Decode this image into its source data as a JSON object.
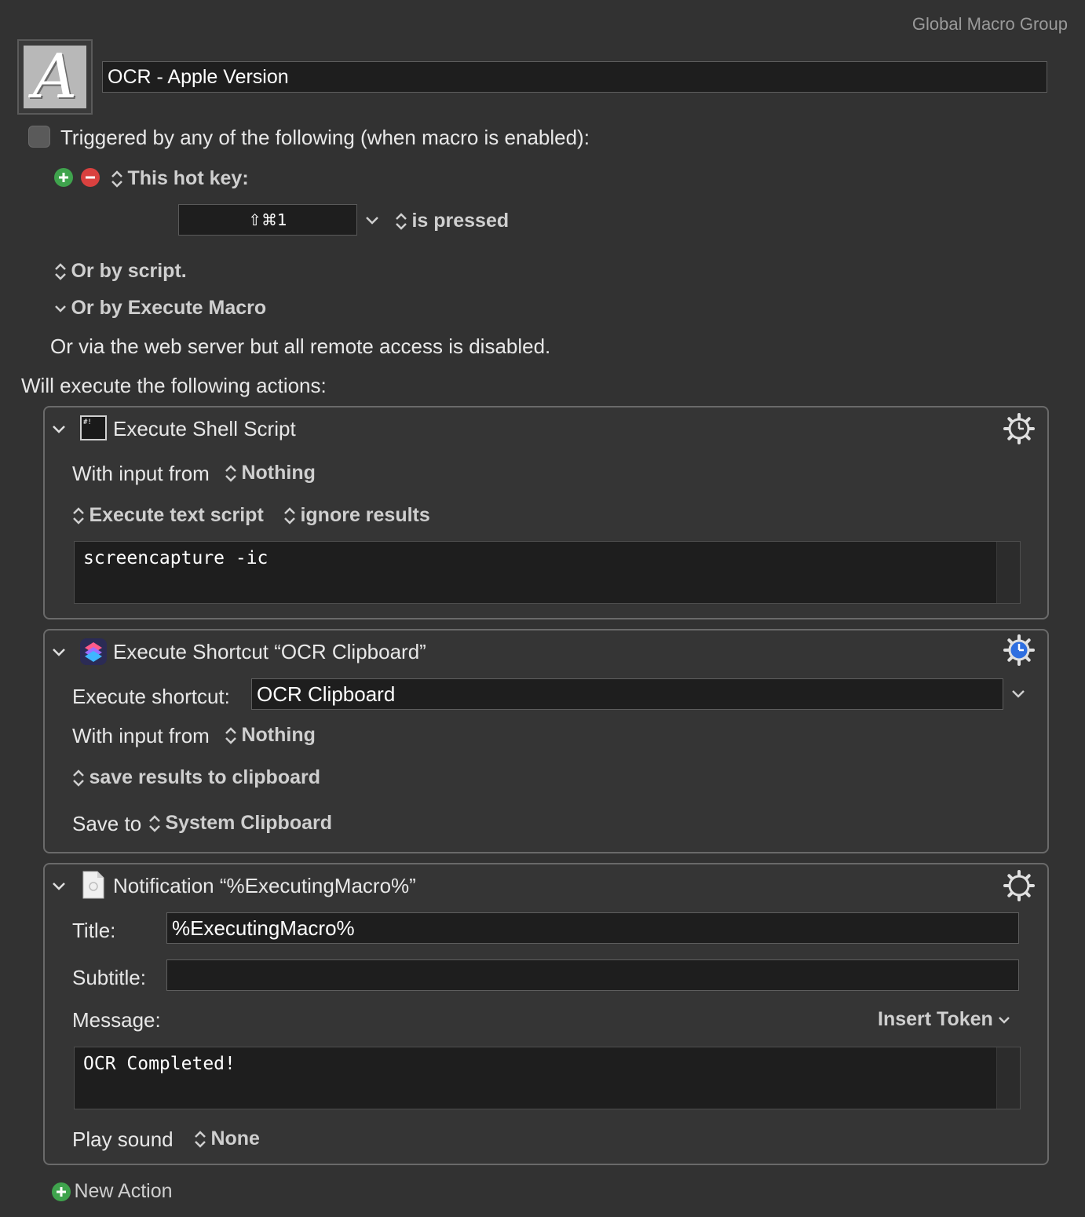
{
  "header": {
    "group": "Global Macro Group",
    "macro_name": "OCR - Apple Version"
  },
  "triggers": {
    "heading": "Triggered by any of the following (when macro is enabled):",
    "hotkey_label": "This hot key:",
    "hotkey_value": "⇧⌘1",
    "hotkey_state": "is pressed",
    "by_script": "Or by script.",
    "by_execute_macro": "Or by Execute Macro",
    "web_server": "Or via the web server but all remote access is disabled."
  },
  "actions_heading": "Will execute the following actions:",
  "actions": {
    "shell": {
      "title": "Execute Shell Script",
      "input_label": "With input from",
      "input_value": "Nothing",
      "mode": "Execute text script",
      "results": "ignore results",
      "script": "screencapture -ic"
    },
    "shortcut": {
      "title": "Execute Shortcut “OCR Clipboard”",
      "shortcut_label": "Execute shortcut:",
      "shortcut_value": "OCR Clipboard",
      "input_label": "With input from",
      "input_value": "Nothing",
      "results": "save results to clipboard",
      "save_label": "Save to",
      "save_value": "System Clipboard"
    },
    "notification": {
      "title": "Notification “%ExecutingMacro%”",
      "title_label": "Title:",
      "title_value": "%ExecutingMacro%",
      "subtitle_label": "Subtitle:",
      "subtitle_value": "",
      "message_label": "Message:",
      "insert_token": "Insert Token",
      "message_value": "OCR Completed!",
      "sound_label": "Play sound",
      "sound_value": "None"
    }
  },
  "footer": {
    "new_action": "New Action"
  },
  "colors": {
    "background": "#323232",
    "add_green": "#3fa34d",
    "remove_red": "#d9413f"
  }
}
